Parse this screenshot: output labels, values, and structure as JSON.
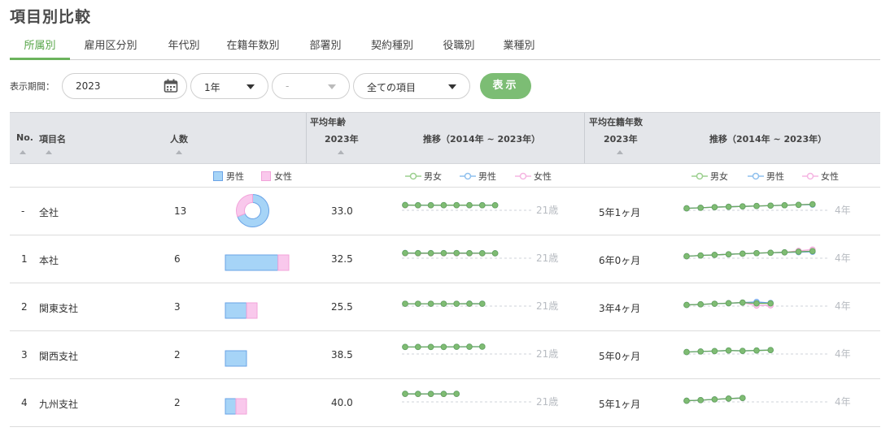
{
  "page_title": "項目別比較",
  "tabs": [
    {
      "label": "所属別",
      "active": true
    },
    {
      "label": "雇用区分別",
      "active": false
    },
    {
      "label": "年代別",
      "active": false
    },
    {
      "label": "在籍年数別",
      "active": false
    },
    {
      "label": "部署別",
      "active": false
    },
    {
      "label": "契約種別",
      "active": false
    },
    {
      "label": "役職別",
      "active": false
    },
    {
      "label": "業種別",
      "active": false
    }
  ],
  "filters": {
    "period_label": "表示期間：",
    "year_value": "2023",
    "span_value": "1年",
    "month_value": "-",
    "items_value": "全ての項目",
    "show_button": "表示"
  },
  "table_header": {
    "no": "No.",
    "item_name": "項目名",
    "headcount": "人数",
    "avg_age_group": "平均年齢",
    "avg_age_year": "2023年",
    "avg_age_trend": "推移（2014年 ~ 2023年）",
    "tenure_group": "平均在籍年数",
    "tenure_year": "2023年",
    "tenure_trend": "推移（2014年 ~ 2023年）"
  },
  "legend": {
    "male": "男性",
    "female": "女性",
    "all": "男女"
  },
  "colors": {
    "accent_green": "#6bb35c",
    "button_green": "#7cbd74",
    "male_fill": "#a6d4f7",
    "male_line": "#6aa3e6",
    "female_fill": "#f9c8ec",
    "female_line": "#f2a3da",
    "all_line": "#6aa85f"
  },
  "age_axis_label": "21歳",
  "tenure_axis_label": "4年",
  "rows": [
    {
      "no": "-",
      "name": "全社",
      "count": "13",
      "viz": "donut",
      "male_ratio": 0.69,
      "avg_age": "33.0",
      "tenure": "5年1ヶ月",
      "age_trend": {
        "all": [
          33.4,
          33.0,
          33.0,
          33.1,
          33.2,
          33.1,
          33.0,
          33.0
        ],
        "male": [
          33.6,
          33.1,
          33.1,
          33.2,
          33.3,
          33.2,
          33.1,
          33.0
        ],
        "female": [
          32.9,
          32.7,
          32.8,
          32.9,
          32.9,
          32.8,
          32.9,
          33.0
        ]
      },
      "tenure_trend": {
        "all": [
          3.0,
          3.3,
          3.6,
          3.8,
          4.0,
          4.2,
          4.4,
          4.6,
          4.8,
          5.1
        ],
        "male": [
          3.0,
          3.3,
          3.6,
          3.8,
          4.0,
          4.2,
          4.4,
          4.6,
          4.8,
          4.9
        ],
        "female": [
          3.0,
          3.3,
          3.6,
          3.8,
          4.0,
          4.2,
          4.4,
          4.6,
          4.8,
          5.1
        ]
      }
    },
    {
      "no": "1",
      "name": "本社",
      "count": "6",
      "viz": "bar",
      "male_ratio": 0.83,
      "avg_age": "32.5",
      "tenure": "6年0ヶ月",
      "age_trend": {
        "all": [
          33.2,
          32.9,
          32.9,
          33.0,
          33.1,
          32.8,
          32.7,
          32.7
        ],
        "male": [
          33.4,
          33.1,
          33.1,
          33.2,
          33.3,
          33.0,
          32.8,
          32.7
        ],
        "female": [
          32.5,
          32.3,
          32.3,
          32.4,
          32.4,
          32.4,
          32.5,
          32.5
        ]
      },
      "tenure_trend": {
        "all": [
          3.0,
          3.4,
          3.7,
          4.0,
          4.3,
          4.6,
          4.8,
          5.0,
          5.3,
          5.6
        ],
        "male": [
          3.0,
          3.4,
          3.7,
          4.0,
          4.3,
          4.6,
          4.8,
          5.0,
          5.1,
          5.3
        ],
        "female": [
          3.0,
          3.4,
          3.7,
          4.0,
          4.3,
          4.6,
          4.8,
          5.0,
          5.8,
          6.4
        ]
      }
    },
    {
      "no": "2",
      "name": "関東支社",
      "count": "3",
      "viz": "bar",
      "male_ratio": 0.67,
      "avg_age": "25.5",
      "tenure": "3年4ヶ月",
      "age_trend": {
        "all": [
          26.0,
          26.0,
          26.0,
          26.0,
          26.0,
          26.1,
          26.0
        ],
        "male": [
          26.0,
          26.0,
          26.0,
          26.0,
          26.0,
          26.3,
          26.1
        ],
        "female": [
          26.0,
          26.0,
          26.0,
          26.0,
          26.0,
          26.0,
          26.0
        ]
      },
      "tenure_trend": {
        "all": [
          2.6,
          2.9,
          3.2,
          3.5,
          3.8,
          3.4,
          3.4
        ],
        "male": [
          2.6,
          2.9,
          3.2,
          3.5,
          3.8,
          4.1,
          3.6
        ],
        "female": [
          2.6,
          2.9,
          3.2,
          3.5,
          3.8,
          2.3,
          2.4
        ]
      }
    },
    {
      "no": "3",
      "name": "関西支社",
      "count": "2",
      "viz": "bar",
      "male_ratio": 1.0,
      "avg_age": "38.5",
      "tenure": "5年0ヶ月",
      "age_trend": {
        "all": [
          38.0,
          38.0,
          38.1,
          38.2,
          38.5,
          38.7,
          38.8
        ],
        "male": [
          38.0,
          38.0,
          38.1,
          38.2,
          38.5,
          38.7,
          38.8
        ],
        "female": []
      },
      "tenure_trend": {
        "all": [
          3.0,
          3.3,
          3.5,
          3.8,
          3.6,
          3.8,
          4.0
        ],
        "male": [
          3.0,
          3.3,
          3.5,
          3.8,
          3.6,
          3.8,
          4.0
        ],
        "female": []
      }
    },
    {
      "no": "4",
      "name": "九州支社",
      "count": "2",
      "viz": "bar",
      "male_ratio": 0.5,
      "avg_age": "40.0",
      "tenure": "5年1ヶ月",
      "age_trend": {
        "all": [
          40.6,
          40.4,
          40.5,
          40.5,
          40.6
        ],
        "male": [
          40.8,
          40.6,
          40.7,
          40.7,
          40.8
        ],
        "female": [
          40.4,
          40.2,
          40.3,
          40.3,
          40.4
        ]
      },
      "tenure_trend": {
        "all": [
          2.6,
          2.9,
          3.3,
          3.7,
          4.0
        ],
        "male": [
          2.6,
          2.9,
          3.3,
          3.7,
          4.0
        ],
        "female": [
          2.6,
          2.9,
          3.3,
          3.7,
          4.0
        ]
      }
    }
  ]
}
